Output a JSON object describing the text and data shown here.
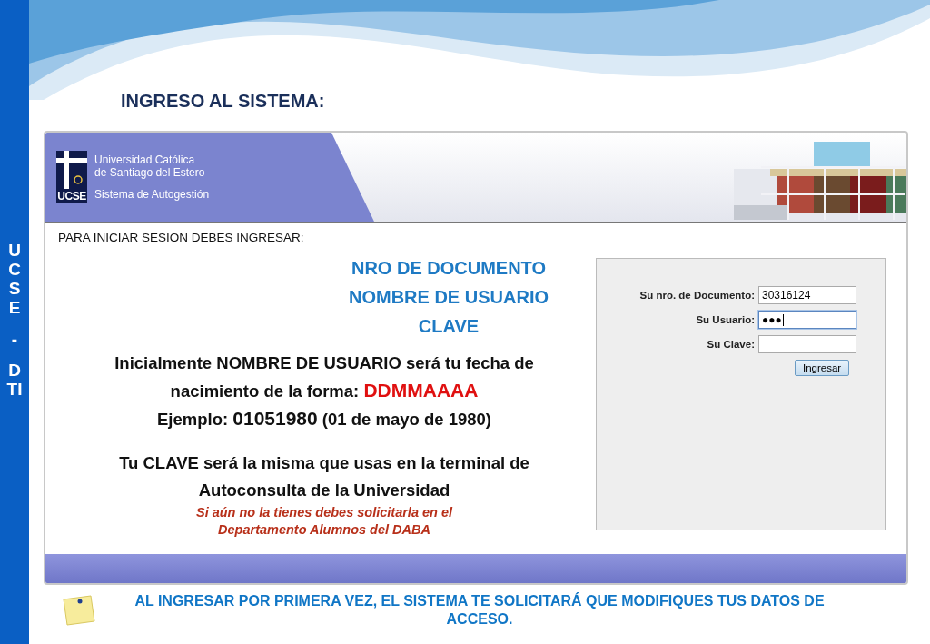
{
  "slide_title": "INGRESO AL SISTEMA:",
  "side_label": [
    "UCSE",
    "-",
    "DTI"
  ],
  "app": {
    "header": {
      "logo_text": "UCSE",
      "university": [
        "Universidad Católica",
        "de Santiago del Estero"
      ],
      "system": "Sistema de Autogestión",
      "picture": {
        "kind": "picture"
      }
    },
    "intro": "PARA INICIAR SESION DEBES INGRESAR:",
    "required": [
      "NRO DE DOCUMENTO",
      "NOMBRE DE USUARIO",
      "CLAVE"
    ],
    "paragraphs": [
      [
        {
          "text": "Inicialmente  NOMBRE DE USUARIO será tu fecha de nacimiento de la forma: ",
          "kind": "plain"
        },
        {
          "text": "DDMMAAAA",
          "kind": "code"
        }
      ],
      [
        {
          "text": "Ejemplo: ",
          "kind": "plain"
        },
        {
          "text": "01051980",
          "kind": "number"
        },
        {
          "text": " (01 de mayo de 1980)",
          "kind": "plain"
        }
      ],
      [
        {
          "text": "Tu CLAVE será la misma que usas en la terminal de Autoconsulta de la Universidad",
          "kind": "plain"
        }
      ]
    ],
    "note": "Si aún no la tienes debes solicitarla en el Departamento Alumnos del DABA",
    "form": {
      "fields": [
        {
          "label": "Su nro. de Documento:",
          "value": "30316124",
          "focused": false
        },
        {
          "label": "Su Usuario:",
          "value": "●●●",
          "focused": true
        },
        {
          "label": "Su Clave:",
          "focused": false
        }
      ],
      "button": "Ingresar"
    }
  },
  "footer": "AL INGRESAR POR PRIMERA VEZ, EL SISTEMA TE SOLICITARÁ QUE MODIFIQUES TUS DATOS DE ACCESO."
}
